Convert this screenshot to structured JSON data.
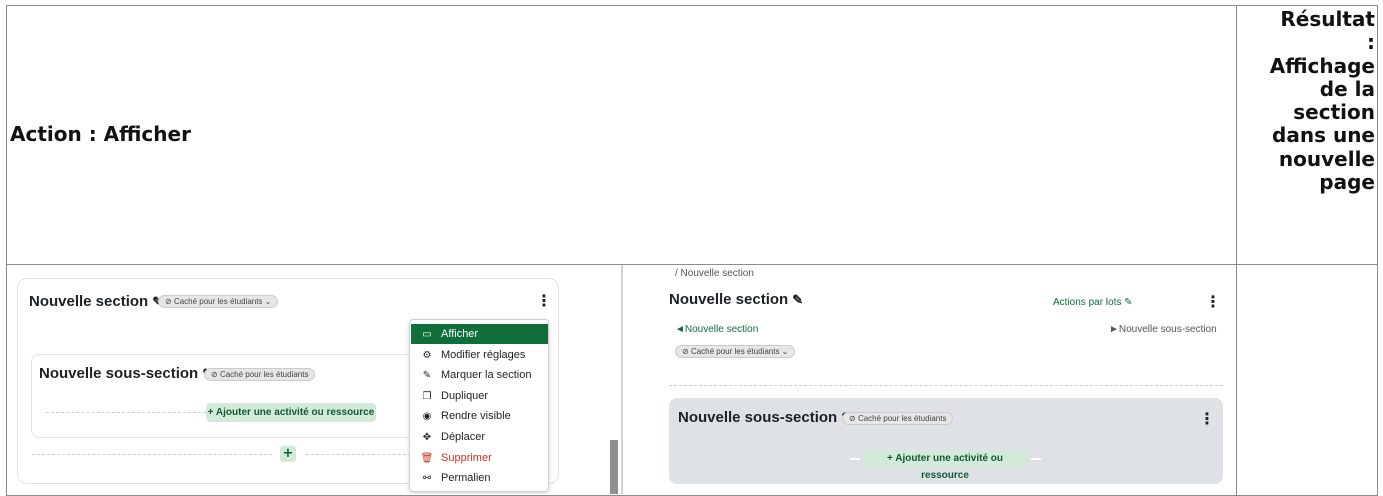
{
  "table": {
    "header_action": "Action : Afficher",
    "header_result": [
      "Résultat",
      ":",
      "Affichage",
      "de la",
      "section",
      "dans une",
      "nouvelle",
      "page"
    ]
  },
  "shot_a": {
    "section_title": "Nouvelle section",
    "hidden_badge": "Caché pour les étudiants",
    "subsection_title": "Nouvelle sous-section",
    "subsection_badge": "Caché pour les étudiants",
    "add_button": "+ Ajouter une activité ou ressource",
    "plus_button": "+",
    "menu": [
      {
        "label": "Afficher",
        "icon": "afficher-icon",
        "glyph": "▭",
        "state": "active"
      },
      {
        "label": "Modifier réglages",
        "icon": "gear-icon",
        "glyph": "⚙",
        "state": "normal"
      },
      {
        "label": "Marquer la section",
        "icon": "pencil-icon",
        "glyph": "✎",
        "state": "normal"
      },
      {
        "label": "Dupliquer",
        "icon": "duplicate-icon",
        "glyph": "❐",
        "state": "normal"
      },
      {
        "label": "Rendre visible",
        "icon": "eye-icon",
        "glyph": "◉",
        "state": "normal"
      },
      {
        "label": "Déplacer",
        "icon": "move-icon",
        "glyph": "✥",
        "state": "normal"
      },
      {
        "label": "Supprimer",
        "icon": "trash-icon",
        "glyph": "🗑",
        "state": "danger"
      },
      {
        "label": "Permalien",
        "icon": "link-icon",
        "glyph": "⚯",
        "state": "normal"
      }
    ]
  },
  "shot_b": {
    "breadcrumb": "/ Nouvelle section",
    "section_title": "Nouvelle section",
    "bulk_actions": "Actions par lots",
    "prev_link": "◄Nouvelle section",
    "next_link": "►Nouvelle sous-section",
    "hidden_badge": "Caché pour les étudiants",
    "subsection_title": "Nouvelle sous-section",
    "subsection_badge": "Caché pour les étudiants",
    "add_button": "+ Ajouter une activité ou ressource"
  },
  "colors": {
    "accent_green": "#0f6e3a",
    "danger_red": "#ca3120",
    "add_button_bg": "#d4ead9"
  }
}
